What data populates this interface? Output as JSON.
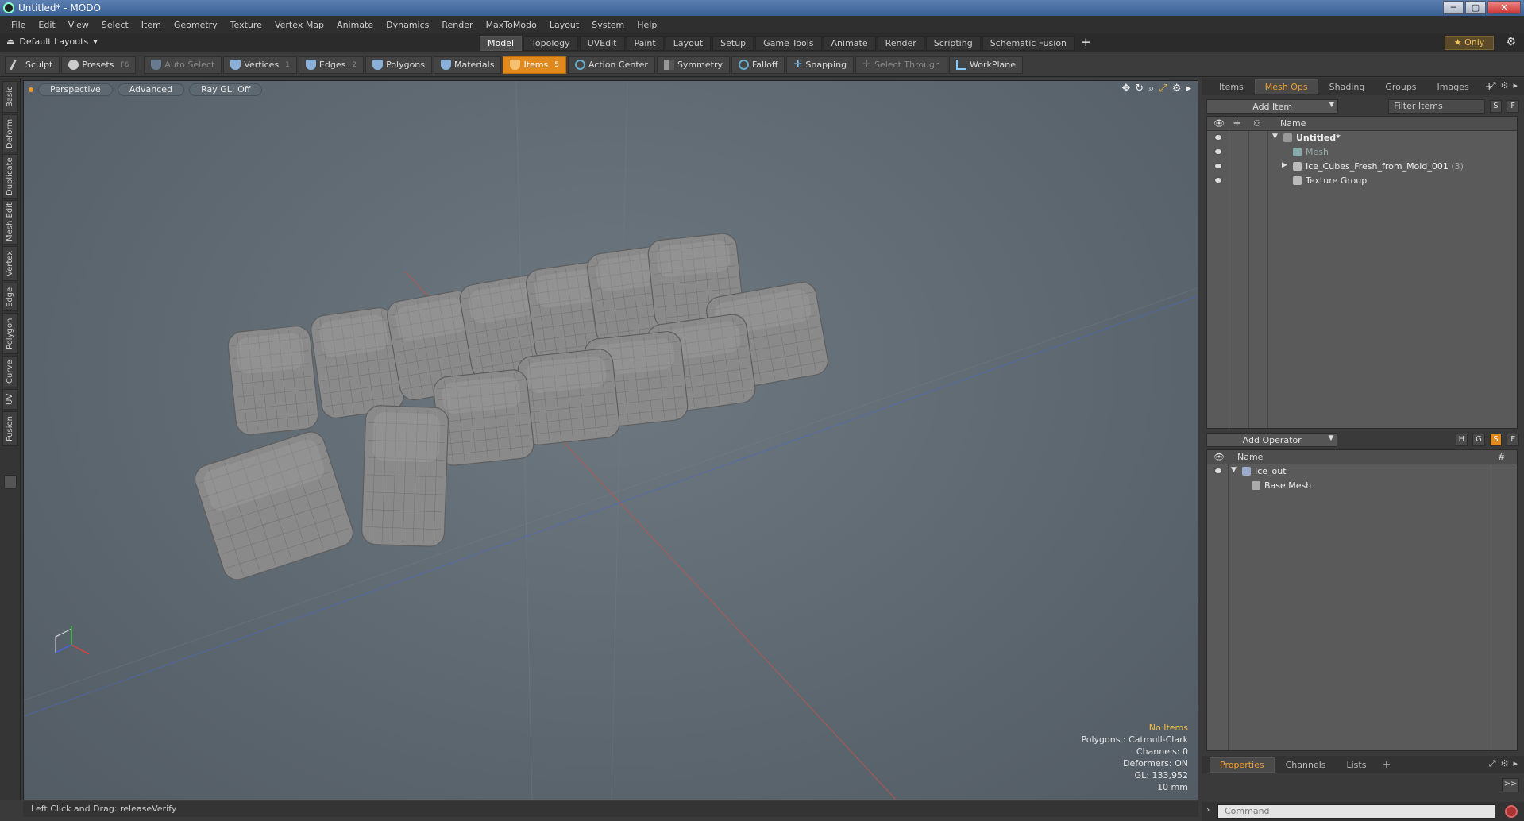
{
  "window": {
    "title": "Untitled* - MODO",
    "min": "─",
    "max": "▢",
    "close": "✕"
  },
  "menu": [
    "File",
    "Edit",
    "View",
    "Select",
    "Item",
    "Geometry",
    "Texture",
    "Vertex Map",
    "Animate",
    "Dynamics",
    "Render",
    "MaxToModo",
    "Layout",
    "System",
    "Help"
  ],
  "layoutbar": {
    "layout_label": "Default Layouts",
    "tabs": [
      "Model",
      "Topology",
      "UVEdit",
      "Paint",
      "Layout",
      "Setup",
      "Game Tools",
      "Animate",
      "Render",
      "Scripting",
      "Schematic Fusion"
    ],
    "active_tab": "Model",
    "plus": "+",
    "only": "★ Only"
  },
  "toolbar": {
    "sculpt": "Sculpt",
    "presets": "Presets",
    "presets_hk": "F6",
    "auto_select": "Auto Select",
    "vertices": "Vertices",
    "vertices_hk": "1",
    "edges": "Edges",
    "edges_hk": "2",
    "polygons": "Polygons",
    "materials": "Materials",
    "items": "Items",
    "items_hk": "5",
    "action_center": "Action Center",
    "symmetry": "Symmetry",
    "falloff": "Falloff",
    "snapping": "Snapping",
    "select_through": "Select Through",
    "workplane": "WorkPlane"
  },
  "left_tabs": [
    "Basic",
    "Deform",
    "Duplicate",
    "Mesh Edit",
    "Vertex",
    "Edge",
    "Polygon",
    "Curve",
    "UV",
    "Fusion"
  ],
  "viewport": {
    "view": "Perspective",
    "shading": "Advanced",
    "raygl": "Ray GL: Off",
    "info": {
      "no_items": "No Items",
      "polygons": "Polygons : Catmull-Clark",
      "channels": "Channels: 0",
      "deformers": "Deformers: ON",
      "gl": "GL: 133,952",
      "scale": "10 mm"
    }
  },
  "status": "Left Click and Drag:   releaseVerify",
  "items_panel": {
    "tabs": [
      "Items",
      "Mesh Ops",
      "Shading",
      "Groups",
      "Images"
    ],
    "active_tab": "Mesh Ops",
    "add_item": "Add Item",
    "filter": "Filter Items",
    "s": "S",
    "f": "F",
    "col_name": "Name",
    "rows": [
      {
        "label": "Untitled*"
      },
      {
        "label": "Mesh"
      },
      {
        "label": "Ice_Cubes_Fresh_from_Mold_001",
        "count": "(3)"
      },
      {
        "label": "Texture Group"
      }
    ]
  },
  "meshops_panel": {
    "add_operator": "Add Operator",
    "h": "H",
    "g": "G",
    "s": "S",
    "f": "F",
    "col_name": "Name",
    "col_hash": "#",
    "rows": [
      {
        "label": "Ice_out"
      },
      {
        "label": "Base Mesh"
      }
    ]
  },
  "props_panel": {
    "tabs": [
      "Properties",
      "Channels",
      "Lists"
    ],
    "active_tab": "Properties",
    "expand": ">>"
  },
  "command": {
    "placeholder": "Command"
  }
}
